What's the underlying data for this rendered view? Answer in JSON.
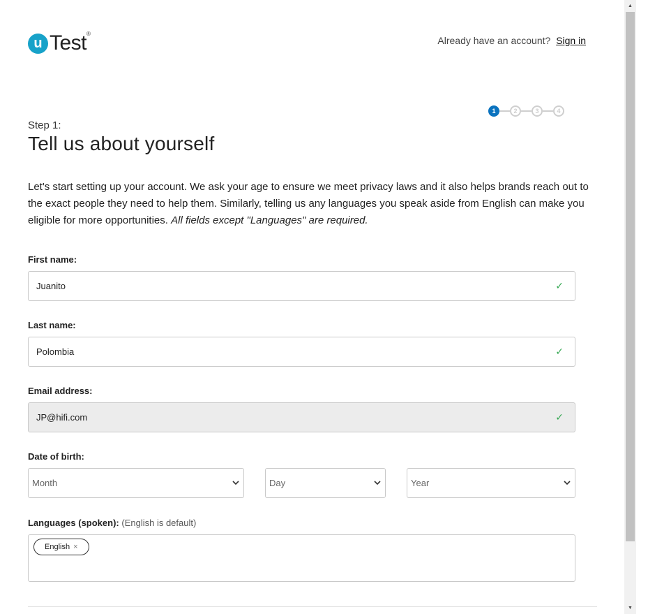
{
  "header": {
    "logo_letter": "u",
    "logo_text": "Test",
    "logo_reg": "®",
    "account_prompt": "Already have an account?",
    "sign_in": "Sign in"
  },
  "stepper": {
    "steps": [
      "1",
      "2",
      "3",
      "4"
    ],
    "active_step": 1
  },
  "page": {
    "step_label": "Step 1:",
    "title": "Tell us about yourself",
    "intro": "Let's start setting up your account. We ask your age to ensure we meet privacy laws and it also helps brands reach out to the exact people they need to help them. Similarly, telling us any languages you speak aside from English can make you eligible for more opportunities. ",
    "intro_emphasis": "All fields except \"Languages\" are required."
  },
  "form": {
    "first_name": {
      "label": "First name:",
      "value": "Juanito"
    },
    "last_name": {
      "label": "Last name:",
      "value": "Polombia"
    },
    "email": {
      "label": "Email address:",
      "value": "JP@hifi.com"
    },
    "dob": {
      "label": "Date of birth:",
      "month": "Month",
      "day": "Day",
      "year": "Year"
    },
    "languages": {
      "label": "Languages (spoken):",
      "hint": "(English is default)",
      "chips": [
        "English"
      ],
      "remove_glyph": "×"
    },
    "check_glyph": "✓"
  },
  "colors": {
    "accent": "#0a73bf",
    "logo": "#17a2c9",
    "valid": "#35a852",
    "disabled_bg": "#ececec"
  },
  "icons": {
    "valid": "checkmark-icon",
    "select": "chevron-down-icon",
    "remove": "close-icon"
  }
}
